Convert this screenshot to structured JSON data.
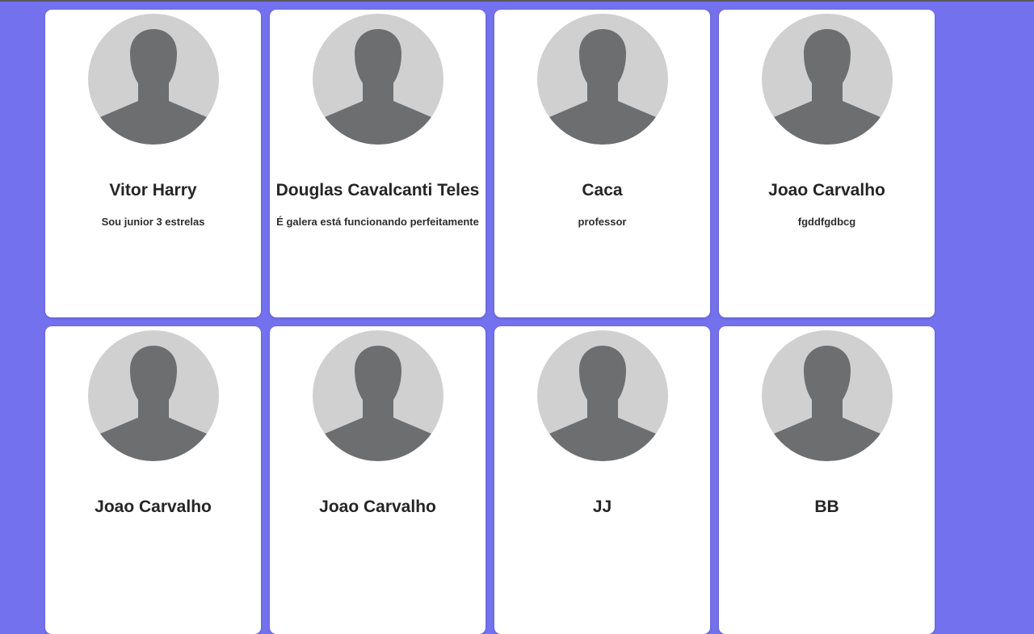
{
  "icons": {
    "avatar": "person-silhouette-icon"
  },
  "colors": {
    "background": "#7371ee",
    "card": "#ffffff",
    "avatar_bg": "#d0d0d0",
    "avatar_fg": "#6d6e70"
  },
  "cards": [
    {
      "name": "Vitor Harry",
      "bio": "Sou junior 3 estrelas"
    },
    {
      "name": "Douglas Cavalcanti Teles",
      "bio": "É galera está funcionando perfeitamente"
    },
    {
      "name": "Caca",
      "bio": "professor"
    },
    {
      "name": "Joao Carvalho",
      "bio": "fgddfgdbcg"
    },
    {
      "name": "Joao Carvalho",
      "bio": ""
    },
    {
      "name": "Joao Carvalho",
      "bio": ""
    },
    {
      "name": "JJ",
      "bio": ""
    },
    {
      "name": "BB",
      "bio": ""
    }
  ]
}
